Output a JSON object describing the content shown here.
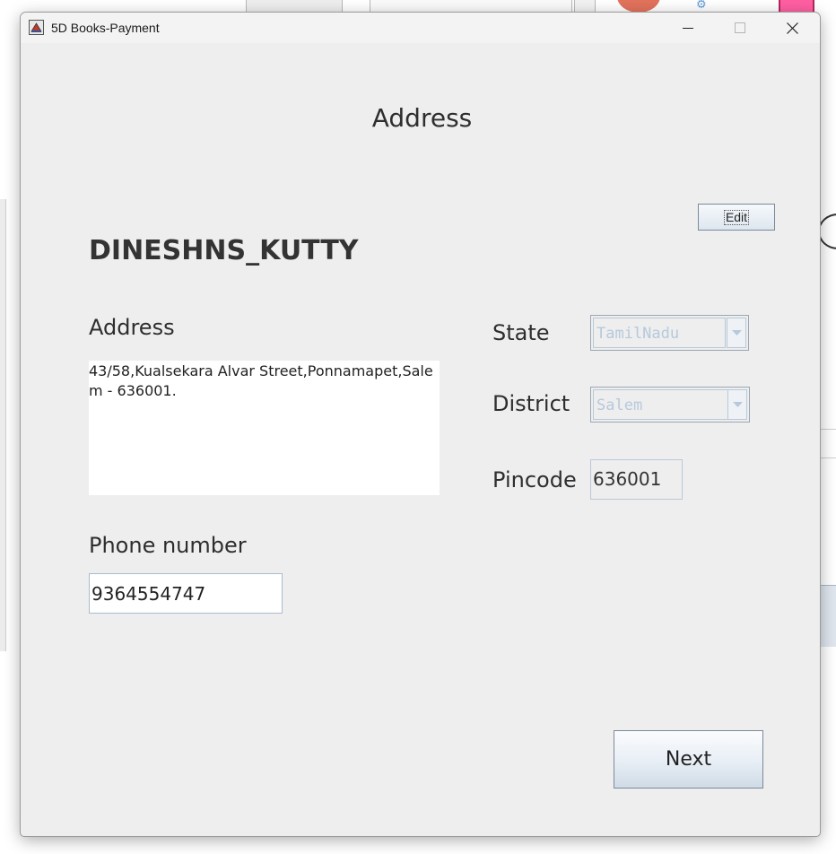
{
  "window": {
    "title": "5D Books-Payment"
  },
  "page": {
    "heading": "Address",
    "username": "DINESHNS_KUTTY",
    "edit_label": "Edit",
    "next_label": "Next"
  },
  "form": {
    "address_label": "Address",
    "address_value": "43/58,Kualsekara Alvar Street,Ponnamapet,Salem - 636001.",
    "phone_label": "Phone number",
    "phone_value": "9364554747",
    "state_label": "State",
    "state_value": "TamilNadu",
    "district_label": "District",
    "district_value": "Salem",
    "pincode_label": "Pincode",
    "pincode_value": "636001"
  },
  "icons": {
    "app": "java-app-icon",
    "minimize": "minimize-icon",
    "maximize": "maximize-icon",
    "close": "close-icon",
    "dropdown": "chevron-down-icon"
  },
  "colors": {
    "window_bg": "#eeeeee",
    "disabled_text": "#b6c9dc",
    "button_gradient_bottom": "#cfdbe6"
  }
}
